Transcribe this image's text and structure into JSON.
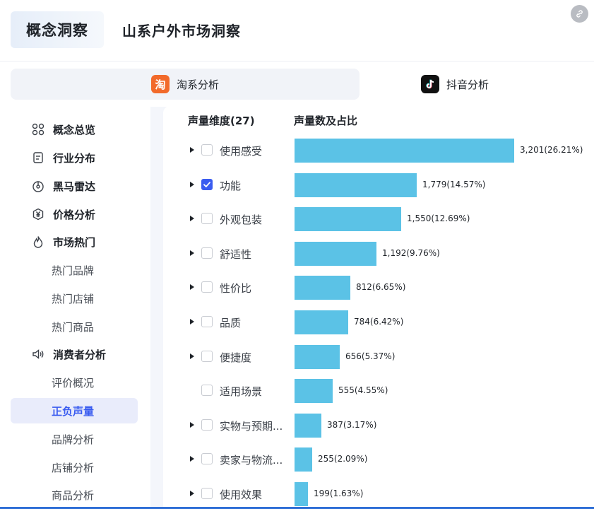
{
  "header": {
    "logo_text": "概念洞察",
    "page_title": "山系户外市场洞察"
  },
  "tabs": [
    {
      "label": "淘系分析",
      "icon": "taobao-icon",
      "icon_char": "淘",
      "color": "#f26a2b",
      "active": true
    },
    {
      "label": "抖音分析",
      "icon": "douyin-icon",
      "icon_char": "♪",
      "color": "#111111",
      "active": false
    }
  ],
  "sidebar": {
    "items": [
      {
        "label": "概念总览",
        "icon": "grid-icon",
        "type": "parent"
      },
      {
        "label": "行业分布",
        "icon": "document-icon",
        "type": "parent"
      },
      {
        "label": "黑马雷达",
        "icon": "radar-icon",
        "type": "parent"
      },
      {
        "label": "价格分析",
        "icon": "price-icon",
        "type": "parent"
      },
      {
        "label": "市场热门",
        "icon": "fire-icon",
        "type": "parent"
      },
      {
        "label": "热门品牌",
        "type": "sub"
      },
      {
        "label": "热门店铺",
        "type": "sub"
      },
      {
        "label": "热门商品",
        "type": "sub"
      },
      {
        "label": "消费者分析",
        "icon": "speaker-icon",
        "type": "parent"
      },
      {
        "label": "评价概况",
        "type": "sub"
      },
      {
        "label": "正负声量",
        "type": "sub",
        "selected": true
      },
      {
        "label": "品牌分析",
        "type": "sub"
      },
      {
        "label": "店铺分析",
        "type": "sub"
      },
      {
        "label": "商品分析",
        "type": "sub"
      }
    ]
  },
  "table": {
    "col_dimension": "声量维度(27)",
    "col_volume": "声量数及占比"
  },
  "chart_data": {
    "type": "bar",
    "orientation": "horizontal",
    "bar_color": "#5bc2e6",
    "categories": [
      "使用感受",
      "功能",
      "外观包装",
      "舒适性",
      "性价比",
      "品质",
      "便捷度",
      "适用场景",
      "实物与预期...",
      "卖家与物流...",
      "使用效果"
    ],
    "values": [
      3201,
      1779,
      1550,
      1192,
      812,
      784,
      656,
      555,
      387,
      255,
      199
    ],
    "value_labels": [
      "3,201(26.21%)",
      "1,779(14.57%)",
      "1,550(12.69%)",
      "1,192(9.76%)",
      "812(6.65%)",
      "784(6.42%)",
      "656(5.37%)",
      "555(4.55%)",
      "387(3.17%)",
      "255(2.09%)",
      "199(1.63%)"
    ],
    "expandable": [
      true,
      true,
      true,
      true,
      true,
      true,
      true,
      false,
      true,
      true,
      true
    ],
    "checked": [
      false,
      true,
      false,
      false,
      false,
      false,
      false,
      false,
      false,
      false,
      false
    ]
  }
}
